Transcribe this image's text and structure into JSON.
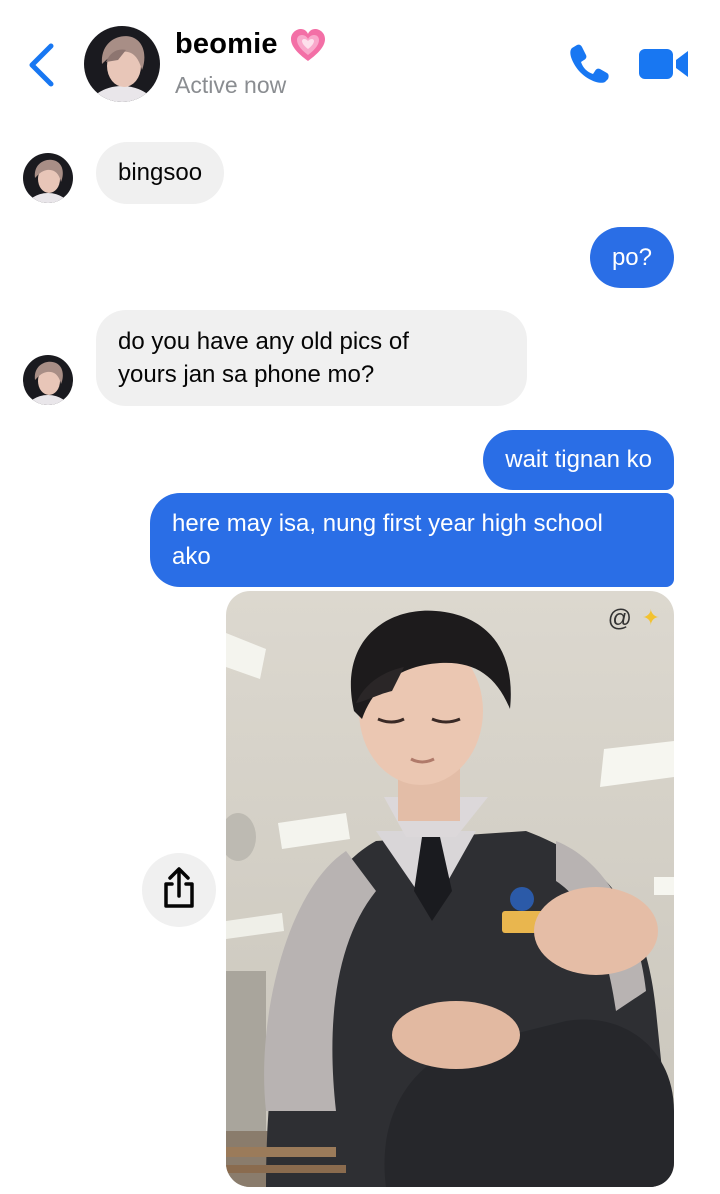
{
  "header": {
    "contact_name": "beomie",
    "status": "Active now",
    "icons": {
      "back": "chevron-left-icon",
      "heart": "pink-heart-icon",
      "phone": "phone-icon",
      "video": "video-camera-icon"
    }
  },
  "colors": {
    "accent": "#1877f2",
    "outgoing_bubble": "#2a6ee6",
    "incoming_bubble": "#f0f0f0",
    "status_text": "#8a8d91"
  },
  "messages": [
    {
      "direction": "incoming",
      "text": "bingsoo"
    },
    {
      "direction": "outgoing",
      "text": "po?"
    },
    {
      "direction": "incoming",
      "lines": [
        "do you have any old pics of",
        "yours jan sa phone mo?"
      ]
    },
    {
      "direction": "outgoing",
      "text": "wait tignan ko"
    },
    {
      "direction": "outgoing",
      "lines": [
        "here may isa, nung first year high school",
        "ako"
      ]
    },
    {
      "direction": "outgoing",
      "type": "photo",
      "overlay_text": "@",
      "overlay_icon": "sparkles-icon"
    }
  ],
  "share_icon": "share-icon"
}
